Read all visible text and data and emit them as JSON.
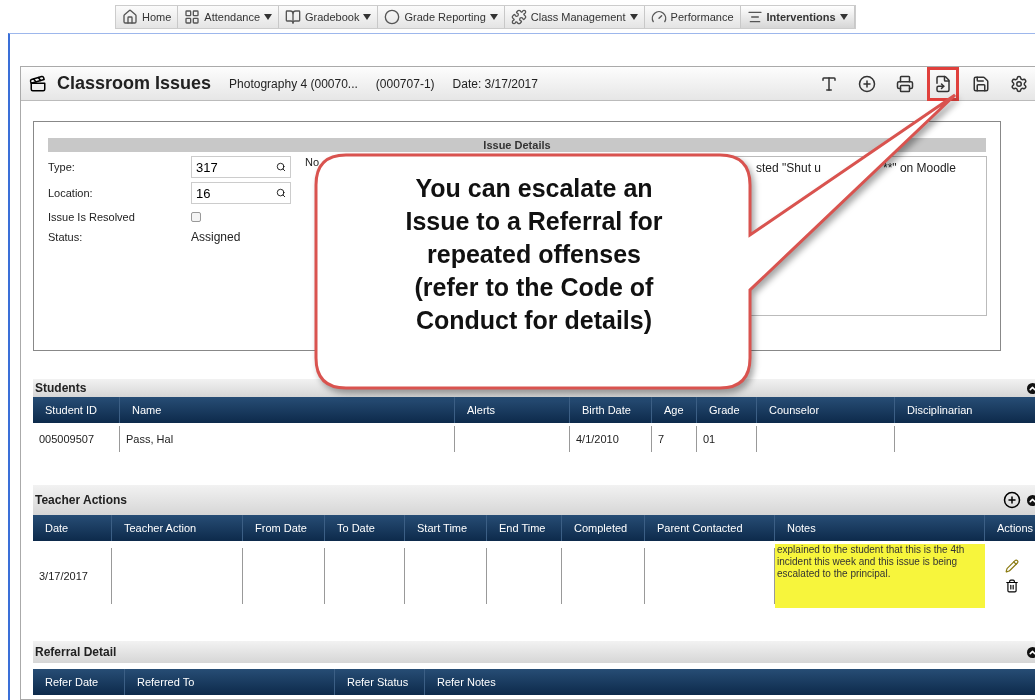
{
  "nav": [
    {
      "label": "Home",
      "dropdown": false,
      "selected": false
    },
    {
      "label": "Attendance",
      "dropdown": true,
      "selected": false
    },
    {
      "label": "Gradebook",
      "dropdown": true,
      "selected": false
    },
    {
      "label": "Grade Reporting",
      "dropdown": true,
      "selected": false
    },
    {
      "label": "Class Management",
      "dropdown": true,
      "selected": false
    },
    {
      "label": "Performance",
      "dropdown": false,
      "selected": false
    },
    {
      "label": "Interventions",
      "dropdown": true,
      "selected": true
    }
  ],
  "header": {
    "title": "Classroom Issues",
    "section": "Photography 4 (00070...",
    "section_id": "(000707-1)",
    "date": "Date: 3/17/2017",
    "toolbar": [
      {
        "highlighted": false
      },
      {
        "highlighted": false
      },
      {
        "highlighted": false
      },
      {
        "highlighted": true
      },
      {
        "highlighted": false
      },
      {
        "highlighted": false
      }
    ]
  },
  "issue_details": {
    "title": "Issue Details",
    "fields": [
      {
        "kind": "lookup",
        "label": "Type:",
        "value": "317"
      },
      {
        "kind": "lookup",
        "label": "Location:",
        "value": "16"
      },
      {
        "kind": "checkbox",
        "label": "Issue Is Resolved",
        "checked": false
      },
      {
        "kind": "text",
        "label": "Status:",
        "value": "Assigned"
      }
    ],
    "notes_label": "No",
    "notes_text_start": "sted \"Shut u",
    "notes_text_end": "**\" on Moodle"
  },
  "students": {
    "title": "Students",
    "columns": [
      "Student ID",
      "Name",
      "Alerts",
      "Birth Date",
      "Age",
      "Grade",
      "Counselor",
      "Disciplinarian"
    ],
    "rows": [
      [
        "005009507",
        "Pass, Hal",
        "",
        "4/1/2010",
        "7",
        "01",
        "",
        ""
      ]
    ]
  },
  "teacher_actions": {
    "title": "Teacher Actions",
    "columns": [
      "Date",
      "Teacher Action",
      "From Date",
      "To Date",
      "Start Time",
      "End Time",
      "Completed",
      "Parent Contacted",
      "Notes",
      "Actions"
    ],
    "rows": [
      {
        "cells": [
          "3/17/2017",
          "",
          "",
          "",
          "",
          "",
          "",
          ""
        ],
        "notes": "explained to the student that this is the 4th incident this week and this issue is being escalated to the principal."
      }
    ]
  },
  "referral_detail": {
    "title": "Referral Detail",
    "columns": [
      "Refer Date",
      "Referred To",
      "Refer Status",
      "Refer Notes"
    ]
  },
  "callout": {
    "text": "You can escalate an\nIssue to a Referral for\nrepeated offenses\n(refer to the Code of\nConduct for details)"
  }
}
